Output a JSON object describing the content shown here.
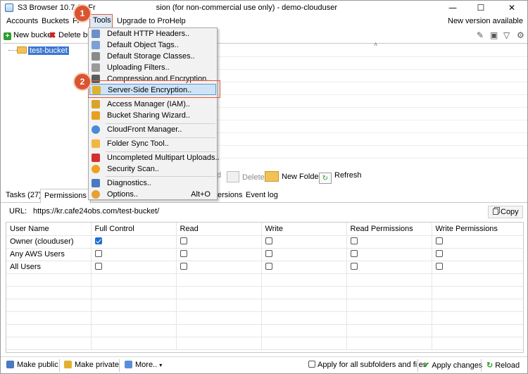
{
  "window": {
    "title": "S3 Browser 10.7.1 - Free version (for non-commercial use only) - demo-clouduser",
    "title_visible_prefix": "S3 Browser 10.7.1 - Fr",
    "title_visible_suffix": "sion (for non-commercial use only) - demo-clouduser",
    "min": "—",
    "max": "☐",
    "close": "✕"
  },
  "menubar": {
    "accounts": "Accounts",
    "buckets": "Buckets",
    "files": "Fi",
    "tools": "Tools",
    "upgrade": "Upgrade to Pro!",
    "help": "Help",
    "new_version": "New version available"
  },
  "toolbar": {
    "new_bucket": "New bucket",
    "delete_bucket": "Delete buc"
  },
  "tree": {
    "bucket": "test-bucket"
  },
  "file_toolbar": {
    "download_partial": "d",
    "delete": "Delete",
    "new_folder": "New Folder",
    "refresh": "Refresh"
  },
  "tabs": {
    "tasks": "Tasks (27)",
    "permissions": "Permissions",
    "versions_partial": "ersions",
    "eventlog": "Event log"
  },
  "url": {
    "label": "URL:",
    "value": "https://kr.cafe24obs.com/test-bucket/",
    "copy": "Copy"
  },
  "permissions": {
    "headers": [
      "User Name",
      "Full Control",
      "Read",
      "Write",
      "Read Permissions",
      "Write Permissions"
    ],
    "rows": [
      {
        "user": "Owner (clouduser)",
        "full": true,
        "read": false,
        "write": false,
        "readp": false,
        "writep": false
      },
      {
        "user": "Any AWS Users",
        "full": false,
        "read": false,
        "write": false,
        "readp": false,
        "writep": false
      },
      {
        "user": "All Users",
        "full": false,
        "read": false,
        "write": false,
        "readp": false,
        "writep": false
      }
    ]
  },
  "bottombar": {
    "make_public": "Make public",
    "make_private": "Make private",
    "more": "More..",
    "apply_subfolders": "Apply for all subfolders and files",
    "apply_changes": "Apply changes",
    "reload": "Reload"
  },
  "tools_menu": {
    "items": [
      {
        "label": "Default HTTP Headers..",
        "icon": "headers-icon",
        "color": "#6b8fc7"
      },
      {
        "label": "Default Object Tags..",
        "icon": "tag-icon",
        "color": "#7aa0d8"
      },
      {
        "label": "Default Storage Classes..",
        "icon": "storage-icon",
        "color": "#8a8a8a"
      },
      {
        "label": "Uploading Filters..",
        "icon": "filter-icon",
        "color": "#9a9a9a"
      },
      {
        "label": "Compression and Encryption..",
        "icon": "compress-icon",
        "color": "#5c5c5c"
      },
      {
        "label": "Server-Side Encryption..",
        "icon": "lock-icon",
        "color": "#e0b030"
      },
      {
        "label": "Access Manager (IAM)..",
        "icon": "users-icon",
        "color": "#d9a32a"
      },
      {
        "label": "Bucket Sharing Wizard..",
        "icon": "share-icon",
        "color": "#e8a020"
      },
      {
        "label": "CloudFront Manager..",
        "icon": "globe-icon",
        "color": "#4a8ad6"
      },
      {
        "label": "Folder Sync Tool..",
        "icon": "sync-icon",
        "color": "#f0b840"
      },
      {
        "label": "Uncompleted Multipart Uploads..",
        "icon": "upload-icon",
        "color": "#d43030"
      },
      {
        "label": "Security Scan..",
        "icon": "scan-icon",
        "color": "#f0a020"
      },
      {
        "label": "Diagnostics..",
        "icon": "diagnostics-icon",
        "color": "#4a7ac0"
      },
      {
        "label": "Options..",
        "icon": "options-icon",
        "color": "#e8a030"
      }
    ],
    "options_shortcut": "Alt+O"
  },
  "steps": {
    "one": "1",
    "two": "2"
  },
  "colors": {
    "accent": "#d9542f",
    "highlight": "#cfe3f7",
    "selection": "#3a75d1"
  }
}
